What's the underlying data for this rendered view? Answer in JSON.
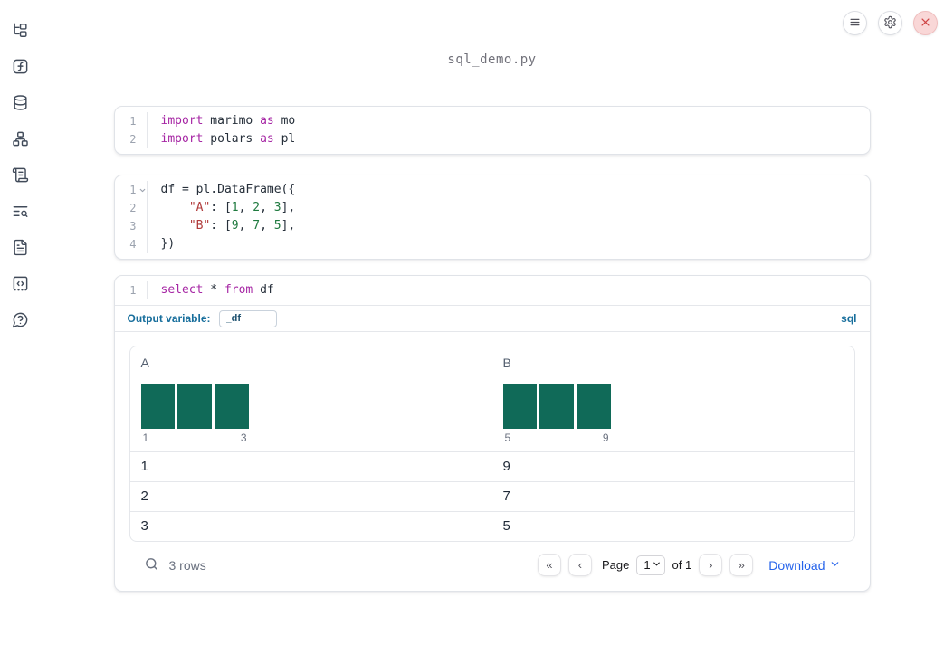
{
  "window": {
    "filename": "sql_demo.py"
  },
  "toolbar": {
    "buttons": [
      {
        "icon": "menu-icon"
      },
      {
        "icon": "settings-gear-icon"
      },
      {
        "icon": "close-icon"
      }
    ]
  },
  "sidebar": {
    "items": [
      {
        "icon": "file-tree-icon"
      },
      {
        "icon": "function-square-icon"
      },
      {
        "icon": "database-icon"
      },
      {
        "icon": "dependency-graph-icon"
      },
      {
        "icon": "scroll-logs-icon"
      },
      {
        "icon": "list-search-icon"
      },
      {
        "icon": "document-icon"
      },
      {
        "icon": "code-snippet-icon"
      },
      {
        "icon": "help-bubble-icon"
      }
    ]
  },
  "cells": [
    {
      "id": "imports",
      "lines": [
        {
          "n": "1",
          "tokens": [
            [
              "kw",
              "import"
            ],
            [
              "plain",
              " marimo "
            ],
            [
              "kw",
              "as"
            ],
            [
              "plain",
              " mo"
            ]
          ]
        },
        {
          "n": "2",
          "tokens": [
            [
              "kw",
              "import"
            ],
            [
              "plain",
              " polars "
            ],
            [
              "kw",
              "as"
            ],
            [
              "plain",
              " pl"
            ]
          ]
        }
      ]
    },
    {
      "id": "dataframe",
      "lines": [
        {
          "n": "1",
          "fold": true,
          "tokens": [
            [
              "plain",
              "df = pl.DataFrame({"
            ]
          ]
        },
        {
          "n": "2",
          "tokens": [
            [
              "plain",
              "    "
            ],
            [
              "str",
              "\"A\""
            ],
            [
              "plain",
              ": ["
            ],
            [
              "num",
              "1"
            ],
            [
              "plain",
              ", "
            ],
            [
              "num",
              "2"
            ],
            [
              "plain",
              ", "
            ],
            [
              "num",
              "3"
            ],
            [
              "plain",
              "],"
            ]
          ]
        },
        {
          "n": "3",
          "tokens": [
            [
              "plain",
              "    "
            ],
            [
              "str",
              "\"B\""
            ],
            [
              "plain",
              ": ["
            ],
            [
              "num",
              "9"
            ],
            [
              "plain",
              ", "
            ],
            [
              "num",
              "7"
            ],
            [
              "plain",
              ", "
            ],
            [
              "num",
              "5"
            ],
            [
              "plain",
              "],"
            ]
          ]
        },
        {
          "n": "4",
          "tokens": [
            [
              "plain",
              "})"
            ]
          ]
        }
      ]
    },
    {
      "id": "sql",
      "lines": [
        {
          "n": "1",
          "tokens": [
            [
              "kw",
              "select"
            ],
            [
              "plain",
              " * "
            ],
            [
              "kw",
              "from"
            ],
            [
              "plain",
              " df"
            ]
          ]
        }
      ]
    }
  ],
  "sql_cell": {
    "output_variable_label": "Output variable:",
    "output_variable_value": "_df",
    "language_badge": "sql"
  },
  "table": {
    "columns": [
      {
        "name": "A",
        "histogram": {
          "values": [
            1,
            1,
            1
          ],
          "min_label": "1",
          "max_label": "3"
        }
      },
      {
        "name": "B",
        "histogram": {
          "values": [
            1,
            1,
            1
          ],
          "min_label": "5",
          "max_label": "9"
        }
      }
    ],
    "rows": [
      [
        "1",
        "9"
      ],
      [
        "2",
        "7"
      ],
      [
        "3",
        "5"
      ]
    ],
    "footer": {
      "row_count": "3 rows",
      "page_label": "Page",
      "page_value": "1",
      "of_label": "of 1",
      "download_label": "Download"
    }
  },
  "icons": {
    "first_page": "«",
    "previous_page": "‹",
    "next_page": "›",
    "last_page": "»"
  },
  "colors": {
    "accent_blue": "#176e9c",
    "link_blue": "#2563eb",
    "histogram_teal": "#106a58",
    "syntax_keyword": "#a626a4",
    "syntax_string": "#b03a3a",
    "syntax_number": "#1f7a3f",
    "close_red": "#cf4444"
  }
}
